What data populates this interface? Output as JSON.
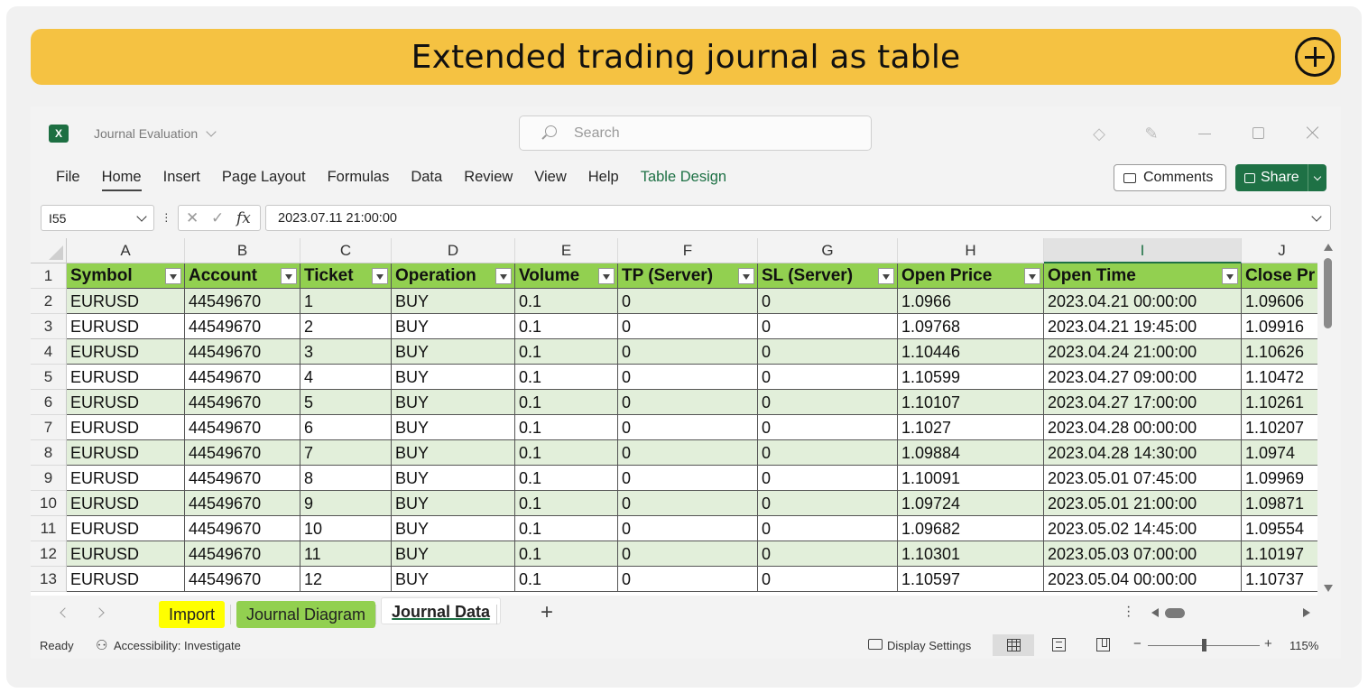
{
  "banner": {
    "title": "Extended trading journal as table"
  },
  "titlebar": {
    "app_icon": "excel-logo",
    "app_icon_letter": "X",
    "doc_name": "Journal Evaluation",
    "search_placeholder": "Search"
  },
  "ribbon": {
    "tabs": [
      "File",
      "Home",
      "Insert",
      "Page Layout",
      "Formulas",
      "Data",
      "Review",
      "View",
      "Help",
      "Table Design"
    ],
    "active_tab": "Home",
    "comments_label": "Comments",
    "share_label": "Share"
  },
  "formula_bar": {
    "name_box": "I55",
    "fx_label": "fx",
    "cancel_glyph": "✕",
    "enter_glyph": "✓",
    "formula": "2023.07.11 21:00:00"
  },
  "sheet": {
    "selected_column": "I",
    "columns": [
      {
        "letter": "A",
        "header": "Symbol"
      },
      {
        "letter": "B",
        "header": "Account"
      },
      {
        "letter": "C",
        "header": "Ticket"
      },
      {
        "letter": "D",
        "header": "Operation"
      },
      {
        "letter": "E",
        "header": "Volume"
      },
      {
        "letter": "F",
        "header": "TP (Server)"
      },
      {
        "letter": "G",
        "header": "SL (Server)"
      },
      {
        "letter": "H",
        "header": "Open Price"
      },
      {
        "letter": "I",
        "header": "Open Time"
      },
      {
        "letter": "J",
        "header": "Close Pr"
      }
    ],
    "row_numbers": [
      "1",
      "2",
      "3",
      "4",
      "5",
      "6",
      "7",
      "8",
      "9",
      "10",
      "11",
      "12",
      "13"
    ],
    "rows": [
      [
        "EURUSD",
        "44549670",
        "1",
        "BUY",
        "0.1",
        "0",
        "0",
        "1.0966",
        "2023.04.21 00:00:00",
        "1.09606"
      ],
      [
        "EURUSD",
        "44549670",
        "2",
        "BUY",
        "0.1",
        "0",
        "0",
        "1.09768",
        "2023.04.21 19:45:00",
        "1.09916"
      ],
      [
        "EURUSD",
        "44549670",
        "3",
        "BUY",
        "0.1",
        "0",
        "0",
        "1.10446",
        "2023.04.24 21:00:00",
        "1.10626"
      ],
      [
        "EURUSD",
        "44549670",
        "4",
        "BUY",
        "0.1",
        "0",
        "0",
        "1.10599",
        "2023.04.27 09:00:00",
        "1.10472"
      ],
      [
        "EURUSD",
        "44549670",
        "5",
        "BUY",
        "0.1",
        "0",
        "0",
        "1.10107",
        "2023.04.27 17:00:00",
        "1.10261"
      ],
      [
        "EURUSD",
        "44549670",
        "6",
        "BUY",
        "0.1",
        "0",
        "0",
        "1.1027",
        "2023.04.28 00:00:00",
        "1.10207"
      ],
      [
        "EURUSD",
        "44549670",
        "7",
        "BUY",
        "0.1",
        "0",
        "0",
        "1.09884",
        "2023.04.28 14:30:00",
        "1.0974"
      ],
      [
        "EURUSD",
        "44549670",
        "8",
        "BUY",
        "0.1",
        "0",
        "0",
        "1.10091",
        "2023.05.01 07:45:00",
        "1.09969"
      ],
      [
        "EURUSD",
        "44549670",
        "9",
        "BUY",
        "0.1",
        "0",
        "0",
        "1.09724",
        "2023.05.01 21:00:00",
        "1.09871"
      ],
      [
        "EURUSD",
        "44549670",
        "10",
        "BUY",
        "0.1",
        "0",
        "0",
        "1.09682",
        "2023.05.02 14:45:00",
        "1.09554"
      ],
      [
        "EURUSD",
        "44549670",
        "11",
        "BUY",
        "0.1",
        "0",
        "0",
        "1.10301",
        "2023.05.03 07:00:00",
        "1.10197"
      ],
      [
        "EURUSD",
        "44549670",
        "12",
        "BUY",
        "0.1",
        "0",
        "0",
        "1.10597",
        "2023.05.04 00:00:00",
        "1.10737"
      ]
    ]
  },
  "sheet_tabs": {
    "tabs": [
      "Import",
      "Journal Diagram",
      "Journal Data"
    ],
    "active": "Journal Data",
    "add_label": "+"
  },
  "status_bar": {
    "ready": "Ready",
    "accessibility": "Accessibility: Investigate",
    "display_settings": "Display Settings",
    "zoom_minus": "−",
    "zoom_plus": "+",
    "zoom": "115%",
    "zoom_fraction": 0.5
  },
  "colors": {
    "banner": "#f5c242",
    "header_green": "#92d050",
    "band_green": "#e2efda",
    "excel_green": "#1e7145",
    "import_tab": "#ffff00"
  }
}
